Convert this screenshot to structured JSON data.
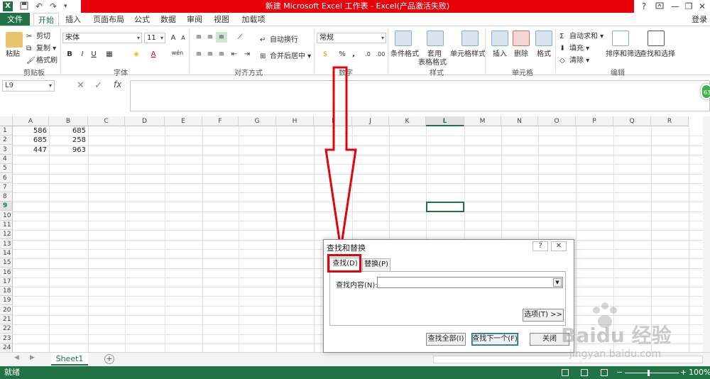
{
  "window": {
    "title": "新建 Microsoft Excel 工作表 - Excel(产品激活失败)",
    "help_btn": "?",
    "minimize": "—",
    "restore": "❐",
    "close": "✕",
    "app_icon": "X"
  },
  "ribbon_tabs": [
    "文件",
    "开始",
    "插入",
    "页面布局",
    "公式",
    "数据",
    "审阅",
    "视图",
    "加载项"
  ],
  "login": "登录",
  "ribbon": {
    "clipboard": {
      "paste": "粘贴",
      "cut": "剪切",
      "copy": "复制",
      "format_painter": "格式刷",
      "label": "剪贴板"
    },
    "font": {
      "font_name": "宋体",
      "font_size": "11",
      "bold": "B",
      "italic": "I",
      "underline": "U",
      "grow": "A",
      "shrink": "A",
      "font_color": "A",
      "phonetic": "wén",
      "label": "字体"
    },
    "alignment": {
      "wrap_text": "自动换行",
      "merge_center": "合并后居中",
      "label": "对齐方式"
    },
    "number": {
      "format": "常规",
      "percent": "%",
      "comma": ",",
      "label": "数字"
    },
    "styles": {
      "conditional": "条件格式",
      "format_as_table_1": "套用",
      "format_as_table_2": "表格格式",
      "cell_styles": "单元格样式",
      "label": "样式"
    },
    "cells": {
      "insert": "插入",
      "delete": "删除",
      "format": "格式",
      "label": "单元格"
    },
    "editing": {
      "autosum": "自动求和",
      "fill": "填充",
      "clear": "清除",
      "sort_filter": "排序和筛选",
      "find_select": "查找和选择",
      "label": "编辑"
    }
  },
  "formula_bar": {
    "name_box": "L9",
    "cancel": "✕",
    "enter": "✓",
    "fx": "fx",
    "value": ""
  },
  "badge": "63",
  "grid": {
    "columns": [
      "A",
      "B",
      "C",
      "D",
      "E",
      "F",
      "G",
      "H",
      "I",
      "J",
      "K",
      "L",
      "M",
      "N",
      "O",
      "P",
      "Q",
      "R"
    ],
    "rows": [
      "1",
      "2",
      "3",
      "4",
      "5",
      "6",
      "7",
      "8",
      "9",
      "10",
      "11",
      "12",
      "13",
      "14",
      "15",
      "16",
      "17",
      "18",
      "19",
      "20",
      "21",
      "22",
      "23",
      "24"
    ],
    "selected_cell": "L9",
    "cells": [
      {
        "row": 1,
        "col": "A",
        "value": "586"
      },
      {
        "row": 1,
        "col": "B",
        "value": "685"
      },
      {
        "row": 2,
        "col": "A",
        "value": "685"
      },
      {
        "row": 2,
        "col": "B",
        "value": "258"
      },
      {
        "row": 3,
        "col": "A",
        "value": "447"
      },
      {
        "row": 3,
        "col": "B",
        "value": "963"
      }
    ]
  },
  "sheets": {
    "active": "Sheet1",
    "add": "+"
  },
  "status": {
    "ready": "就绪",
    "zoom": "100%"
  },
  "dialog": {
    "title": "查找和替换",
    "help": "?",
    "close": "✕",
    "tab_find": "查找(D)",
    "tab_replace": "替换(P)",
    "find_label": "查找内容(N):",
    "find_value": "",
    "options_btn": "选项(T) >>",
    "find_all_btn": "查找全部(I)",
    "find_next_btn": "查找下一个(F)",
    "close_btn": "关闭"
  },
  "watermark": {
    "text": "Baidu 经验",
    "sub": "jingyan.baidu.com"
  },
  "colors": {
    "excel_green": "#217346",
    "title_red": "#e8000b",
    "annotation_red": "#e8000b"
  }
}
